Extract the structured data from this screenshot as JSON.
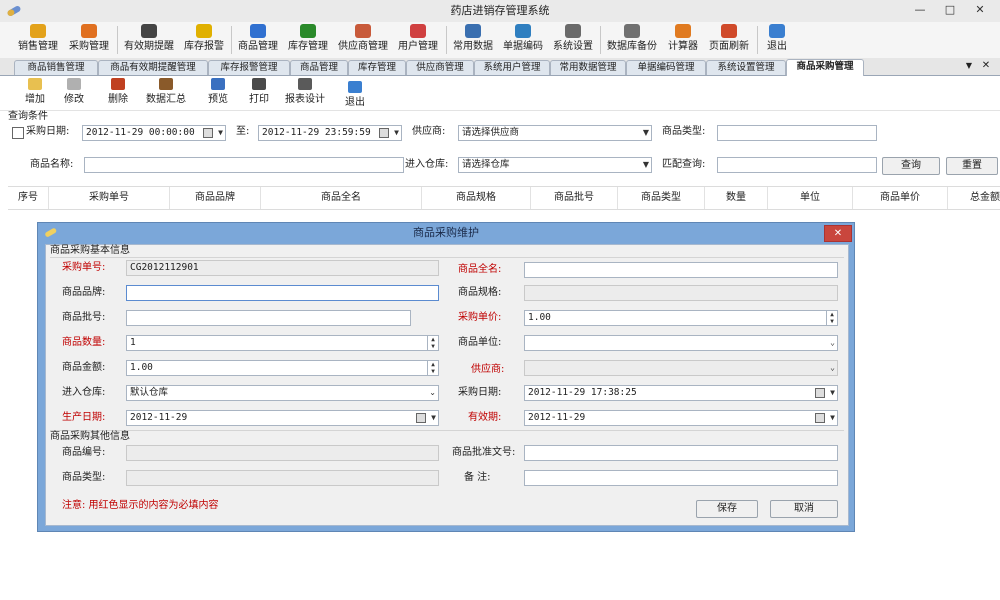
{
  "window": {
    "title": "药店进销存管理系统",
    "minimize": "—",
    "maximize": "□",
    "close": "✕"
  },
  "toolbar": {
    "items": [
      {
        "label": "销售管理",
        "icon": "sales-icon",
        "color": "#e3a21a"
      },
      {
        "label": "采购管理",
        "icon": "purchase-icon",
        "color": "#e07020"
      },
      {
        "label": "有效期提醒",
        "icon": "clock-icon",
        "color": "#444444"
      },
      {
        "label": "库存报警",
        "icon": "warning-icon",
        "color": "#e0b000"
      },
      {
        "label": "商品管理",
        "icon": "pill-icon",
        "color": "#3070d0"
      },
      {
        "label": "库存管理",
        "icon": "inventory-icon",
        "color": "#2a8a2a"
      },
      {
        "label": "供应商管理",
        "icon": "supplier-icon",
        "color": "#c85a3a"
      },
      {
        "label": "用户管理",
        "icon": "user-icon",
        "color": "#d04040"
      },
      {
        "label": "常用数据",
        "icon": "data-icon",
        "color": "#3a6fb0"
      },
      {
        "label": "单据编码",
        "icon": "code-icon",
        "color": "#2f7fc0"
      },
      {
        "label": "系统设置",
        "icon": "tools-icon",
        "color": "#6a6a6a"
      },
      {
        "label": "数据库备份",
        "icon": "database-icon",
        "color": "#707070"
      },
      {
        "label": "计算器",
        "icon": "calculator-icon",
        "color": "#e07a20"
      },
      {
        "label": "页面刷新",
        "icon": "refresh-icon",
        "color": "#d04a2a"
      },
      {
        "label": "退出",
        "icon": "exit-icon",
        "color": "#3a7fd0"
      }
    ]
  },
  "tabs": [
    {
      "label": "商品销售管理"
    },
    {
      "label": "商品有效期提醒管理"
    },
    {
      "label": "库存报警管理"
    },
    {
      "label": "商品管理"
    },
    {
      "label": "库存管理"
    },
    {
      "label": "供应商管理"
    },
    {
      "label": "系统用户管理"
    },
    {
      "label": "常用数据管理"
    },
    {
      "label": "单据编码管理"
    },
    {
      "label": "系统设置管理"
    },
    {
      "label": "商品采购管理",
      "active": true
    }
  ],
  "tab_controls": {
    "dropdown": "▼",
    "close": "✕"
  },
  "subtoolbar": {
    "items": [
      {
        "label": "增加",
        "icon": "add-icon",
        "color": "#e8c050"
      },
      {
        "label": "修改",
        "icon": "edit-icon",
        "color": "#b0b0b0"
      },
      {
        "label": "删除",
        "icon": "delete-icon",
        "color": "#c04020"
      },
      {
        "label": "数据汇总",
        "icon": "summary-icon",
        "color": "#8a5a2a"
      },
      {
        "label": "预览",
        "icon": "preview-icon",
        "color": "#3a70c0"
      },
      {
        "label": "打印",
        "icon": "print-icon",
        "color": "#4a4a4a"
      },
      {
        "label": "报表设计",
        "icon": "report-design-icon",
        "color": "#5a5a5a"
      },
      {
        "label": "退出",
        "icon": "exit-icon",
        "color": "#3a7fd0"
      }
    ]
  },
  "query": {
    "section_label": "查询条件",
    "purchase_date_label": "采购日期:",
    "date_from": "2012-11-29 00:00:00",
    "to_label": "至:",
    "date_to": "2012-11-29 23:59:59",
    "supplier_label": "供应商:",
    "supplier_value": "请选择供应商",
    "product_type_label": "商品类型:",
    "product_type_value": "",
    "product_name_label": "商品名称:",
    "product_name_value": "",
    "warehouse_label": "进入仓库:",
    "warehouse_value": "请选择仓库",
    "match_label": "匹配查询:",
    "match_value": "",
    "search_button": "查询",
    "reset_button": "重置"
  },
  "grid": {
    "columns": [
      "序号",
      "采购单号",
      "商品品牌",
      "商品全名",
      "商品规格",
      "商品批号",
      "商品类型",
      "数量",
      "单位",
      "商品单价",
      "总金额"
    ]
  },
  "dialog": {
    "title": "商品采购维护",
    "close": "✕",
    "basic_section": "商品采购基本信息",
    "other_section": "商品采购其他信息",
    "fields": {
      "order_no_label": "采购单号:",
      "order_no": "CG2012112901",
      "full_name_label": "商品全名:",
      "full_name": "",
      "brand_label": "商品品牌:",
      "brand": "",
      "spec_label": "商品规格:",
      "spec": "",
      "batch_label": "商品批号:",
      "batch": "",
      "unit_price_label": "采购单价:",
      "unit_price": "1.00",
      "quantity_label": "商品数量:",
      "quantity": "1",
      "unit_label": "商品单位:",
      "unit": "",
      "amount_label": "商品金额:",
      "amount": "1.00",
      "supplier_label": "供应商:",
      "supplier": "",
      "warehouse_label": "进入仓库:",
      "warehouse": "默认仓库",
      "purchase_date_label": "采购日期:",
      "purchase_date": "2012-11-29 17:38:25",
      "production_date_label": "生产日期:",
      "production_date": "2012-11-29",
      "expiry_label": "有效期:",
      "expiry": "2012-11-29",
      "product_code_label": "商品编号:",
      "product_code": "",
      "approval_label": "商品批准文号:",
      "approval": "",
      "product_type_label": "商品类型:",
      "product_type": "",
      "remark_label": "备  注:",
      "remark": ""
    },
    "note": "注意: 用红色显示的内容为必填内容",
    "save_button": "保存",
    "cancel_button": "取消"
  }
}
